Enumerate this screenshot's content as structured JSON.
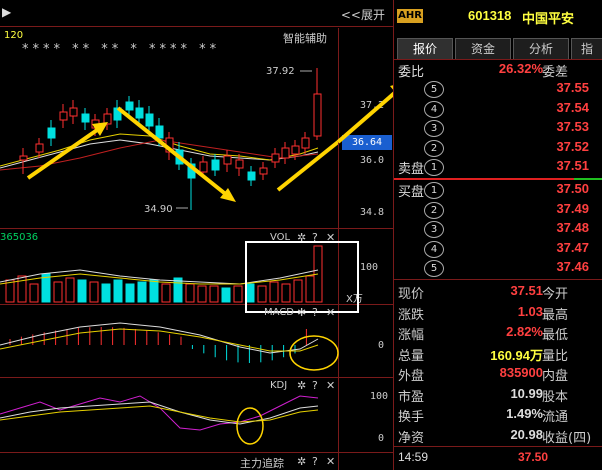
{
  "chart": {
    "expand_label": "<<展开",
    "stars": "**** ** ** * **** **",
    "assist_label": "智能辅助",
    "period_label": "120",
    "high_label": "37.92",
    "low_label": "34.90",
    "current_price": "36.64",
    "axis_top": "37.2",
    "axis_mid": "36.0",
    "axis_low": "34.8",
    "vol_code": "365036",
    "vol_title": "VOL",
    "vol_axis": "100",
    "x_unit": "X万",
    "macd_title": "MACD",
    "macd_axis": "0",
    "kdj_title": "KDJ",
    "kdj_axis_top": "100",
    "kdj_axis_bot": "0",
    "tracker_title": "主力追踪",
    "tool_gear": "✲",
    "tool_help": "?",
    "tool_close": "✕"
  },
  "quote": {
    "badge": "AHR",
    "code": "601318",
    "name": "中国平安",
    "tabs": [
      "报价",
      "资金",
      "分析",
      "指"
    ],
    "weibi_label": "委比",
    "weibi_value": "26.32%",
    "weicha_label": "委差",
    "sell_label": "卖盘",
    "buy_label": "买盘",
    "sell": [
      {
        "idx": "5",
        "price": "37.55"
      },
      {
        "idx": "4",
        "price": "37.54"
      },
      {
        "idx": "3",
        "price": "37.53"
      },
      {
        "idx": "2",
        "price": "37.52"
      },
      {
        "idx": "1",
        "price": "37.51"
      }
    ],
    "buy": [
      {
        "idx": "1",
        "price": "37.50"
      },
      {
        "idx": "2",
        "price": "37.49"
      },
      {
        "idx": "3",
        "price": "37.48"
      },
      {
        "idx": "4",
        "price": "37.47"
      },
      {
        "idx": "5",
        "price": "37.46"
      }
    ],
    "stats": [
      {
        "l1": "现价",
        "v1": "37.51",
        "l2": "今开",
        "color": "#ff4040"
      },
      {
        "l1": "涨跌",
        "v1": "1.03",
        "l2": "最高",
        "color": "#ff4040"
      },
      {
        "l1": "涨幅",
        "v1": "2.82%",
        "l2": "最低",
        "color": "#ff4040"
      },
      {
        "l1": "总量",
        "v1": "160.94万",
        "l2": "量比",
        "color": "#ffff40"
      },
      {
        "l1": "外盘",
        "v1": "835900",
        "l2": "内盘",
        "color": "#ff4040"
      },
      {
        "l1": "市盈",
        "v1": "10.99",
        "l2": "股本",
        "color": "#dddddd"
      },
      {
        "l1": "换手",
        "v1": "1.49%",
        "l2": "流通",
        "color": "#dddddd"
      },
      {
        "l1": "净资",
        "v1": "20.98",
        "l2": "收益(四)",
        "color": "#dddddd"
      }
    ],
    "time": "14:59",
    "last_trade": "37.50"
  },
  "colors": {
    "up": "#ff3030",
    "down": "#00e0e0",
    "accent": "#ffd400",
    "panel_border": "#7a1a1a"
  }
}
